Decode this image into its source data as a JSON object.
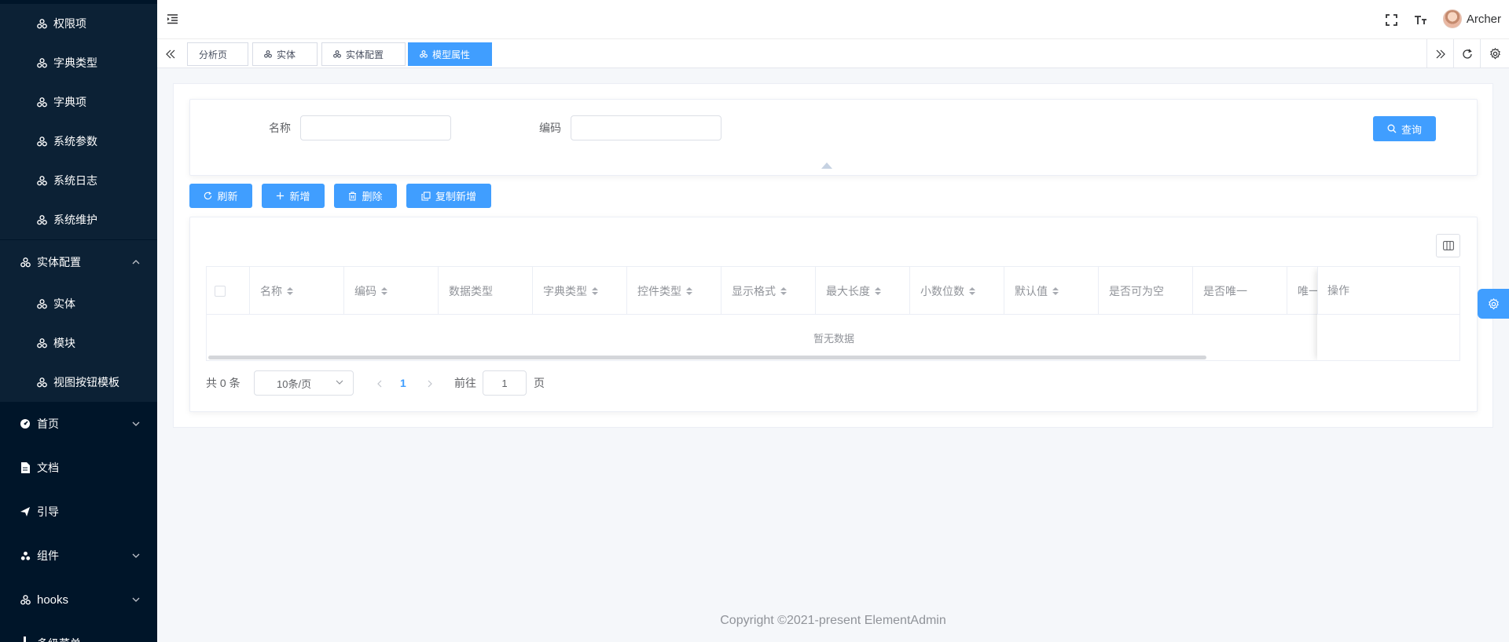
{
  "sidebar": {
    "items": [
      {
        "label": "权限项"
      },
      {
        "label": "字典类型"
      },
      {
        "label": "字典项"
      },
      {
        "label": "系统参数"
      },
      {
        "label": "系统日志"
      },
      {
        "label": "系统维护"
      },
      {
        "label": "实体配置"
      },
      {
        "label": "实体"
      },
      {
        "label": "模块"
      },
      {
        "label": "视图按钮模板"
      },
      {
        "label": "首页"
      },
      {
        "label": "文档"
      },
      {
        "label": "引导"
      },
      {
        "label": "组件"
      },
      {
        "label": "hooks"
      },
      {
        "label": "多级菜单"
      }
    ]
  },
  "header": {
    "username": "Archer"
  },
  "tags": [
    {
      "label": "分析页"
    },
    {
      "label": "实体"
    },
    {
      "label": "实体配置"
    },
    {
      "label": "模型属性"
    }
  ],
  "search": {
    "name_label": "名称",
    "name_value": "",
    "code_label": "编码",
    "code_value": "",
    "query_label": "查询"
  },
  "toolbar": {
    "refresh_label": "刷新",
    "add_label": "新增",
    "delete_label": "删除",
    "copy_add_label": "复制新增"
  },
  "table": {
    "columns": [
      {
        "label": "名称"
      },
      {
        "label": "编码"
      },
      {
        "label": "数据类型"
      },
      {
        "label": "字典类型"
      },
      {
        "label": "控件类型"
      },
      {
        "label": "显示格式"
      },
      {
        "label": "最大长度"
      },
      {
        "label": "小数位数"
      },
      {
        "label": "默认值"
      },
      {
        "label": "是否可为空"
      },
      {
        "label": "是否唯一"
      },
      {
        "label": "唯一"
      },
      {
        "label": "操作"
      }
    ],
    "empty_text": "暂无数据"
  },
  "pagination": {
    "total_text": "共 0 条",
    "page_size": "10条/页",
    "current_page": "1",
    "goto_label": "前往",
    "goto_value": "1",
    "page_suffix": "页"
  },
  "footer": {
    "copyright": "Copyright ©2021-present ElementAdmin"
  },
  "colors": {
    "primary": "#409eff",
    "sidebar_bg": "#001529",
    "submenu_bg": "#0c2135"
  }
}
